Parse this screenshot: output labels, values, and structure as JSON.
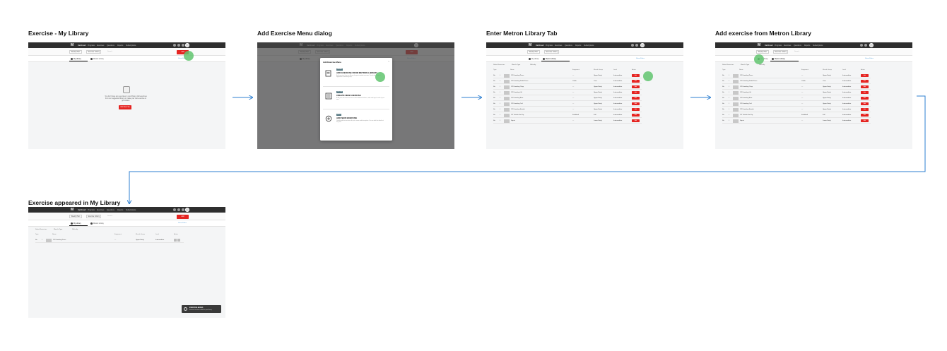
{
  "steps": [
    {
      "title": "Exercise - My Library"
    },
    {
      "title": "Add Exercise Menu dialog"
    },
    {
      "title": "Enter Metron Library Tab"
    },
    {
      "title": "Add exercise from Metron Library"
    },
    {
      "title": "Exercise appeared in My Library"
    }
  ],
  "app": {
    "logo": "M",
    "nav_items": [
      "Dashboard",
      "Programs",
      "Exercises",
      "Questions",
      "Reports",
      "Subscriptions"
    ],
    "add_button": "Add",
    "search_placeholder": "Search",
    "my_library_tab": "My Library",
    "metron_library_tab": "Metron Library",
    "filters_link": "Show Filters",
    "select_label": "Weekly Plan",
    "date_label": "Exercise Library"
  },
  "empty_state": {
    "text": "You don't have any exercises in your library. Add exercises from our suggested library or create your own exercise to get started.",
    "button": "Add Exercise"
  },
  "dialog": {
    "title": "Add Exercise Menu",
    "close": "×",
    "options": [
      {
        "badge": "LIBRARY",
        "title": "ADD EXERCISE FROM METRON LIBRARY",
        "desc": "Add exercises from our library of expert-created exercises. Search by category, equipment or muscle group."
      },
      {
        "badge": "CUSTOM",
        "title": "CREATE NEW EXERCISE",
        "desc": "Build your own exercise from scratch. Add instructions, video and tags to make it your own."
      },
      {
        "badge": "QUICK",
        "title": "ADD NEW EXERCISE",
        "desc": "Quickly add an exercise with just a name and description. You can edit the details at any time."
      }
    ]
  },
  "table": {
    "toolbar": [
      "Select Exercises",
      "Muscle Type",
      "Difficulty"
    ],
    "headers": [
      "Type",
      "Name",
      "Equipment",
      "Muscle Group",
      "Level",
      "Action"
    ],
    "add_label": "Add",
    "rows": [
      {
        "type": "Str",
        "name": "1/2 Kneeling Press",
        "equipment": "—",
        "group": "Upper Body",
        "level": "Intermediate"
      },
      {
        "type": "Str",
        "name": "1/2 Kneeling Pallof Press",
        "equipment": "Cable",
        "group": "Core",
        "level": "Intermediate"
      },
      {
        "type": "Str",
        "name": "1/2 Kneeling Chop",
        "equipment": "—",
        "group": "Upper Body",
        "level": "Intermediate"
      },
      {
        "type": "Str",
        "name": "1/2 Kneeling Lift",
        "equipment": "—",
        "group": "Upper Body",
        "level": "Intermediate"
      },
      {
        "type": "Str",
        "name": "1/2 Kneeling Row",
        "equipment": "—",
        "group": "Upper Body",
        "level": "Intermediate"
      },
      {
        "type": "Str",
        "name": "1/2 Kneeling Curl",
        "equipment": "—",
        "group": "Upper Body",
        "level": "Intermediate"
      },
      {
        "type": "Str",
        "name": "1/2 Kneeling Stretch",
        "equipment": "—",
        "group": "Upper Body",
        "level": "Intermediate"
      },
      {
        "type": "Str",
        "name": "1/2 Turkish Get Up",
        "equipment": "Kettlebell",
        "group": "Full",
        "level": "Intermediate"
      },
      {
        "type": "Str",
        "name": "Squat",
        "equipment": "—",
        "group": "Lower Body",
        "level": "Intermediate"
      }
    ],
    "added_row": {
      "type": "Str",
      "name": "1/2 Kneeling Press",
      "equipment": "—",
      "group": "Upper Body",
      "level": "Intermediate"
    }
  },
  "toast": {
    "title": "EXERCISE ADDED",
    "desc": "Exercise has been added to your library."
  },
  "colors": {
    "accent": "#e52421",
    "flow_arrow": "#2d7fd1",
    "cursor": "#60c46e",
    "navbar": "#2e2e2e"
  }
}
